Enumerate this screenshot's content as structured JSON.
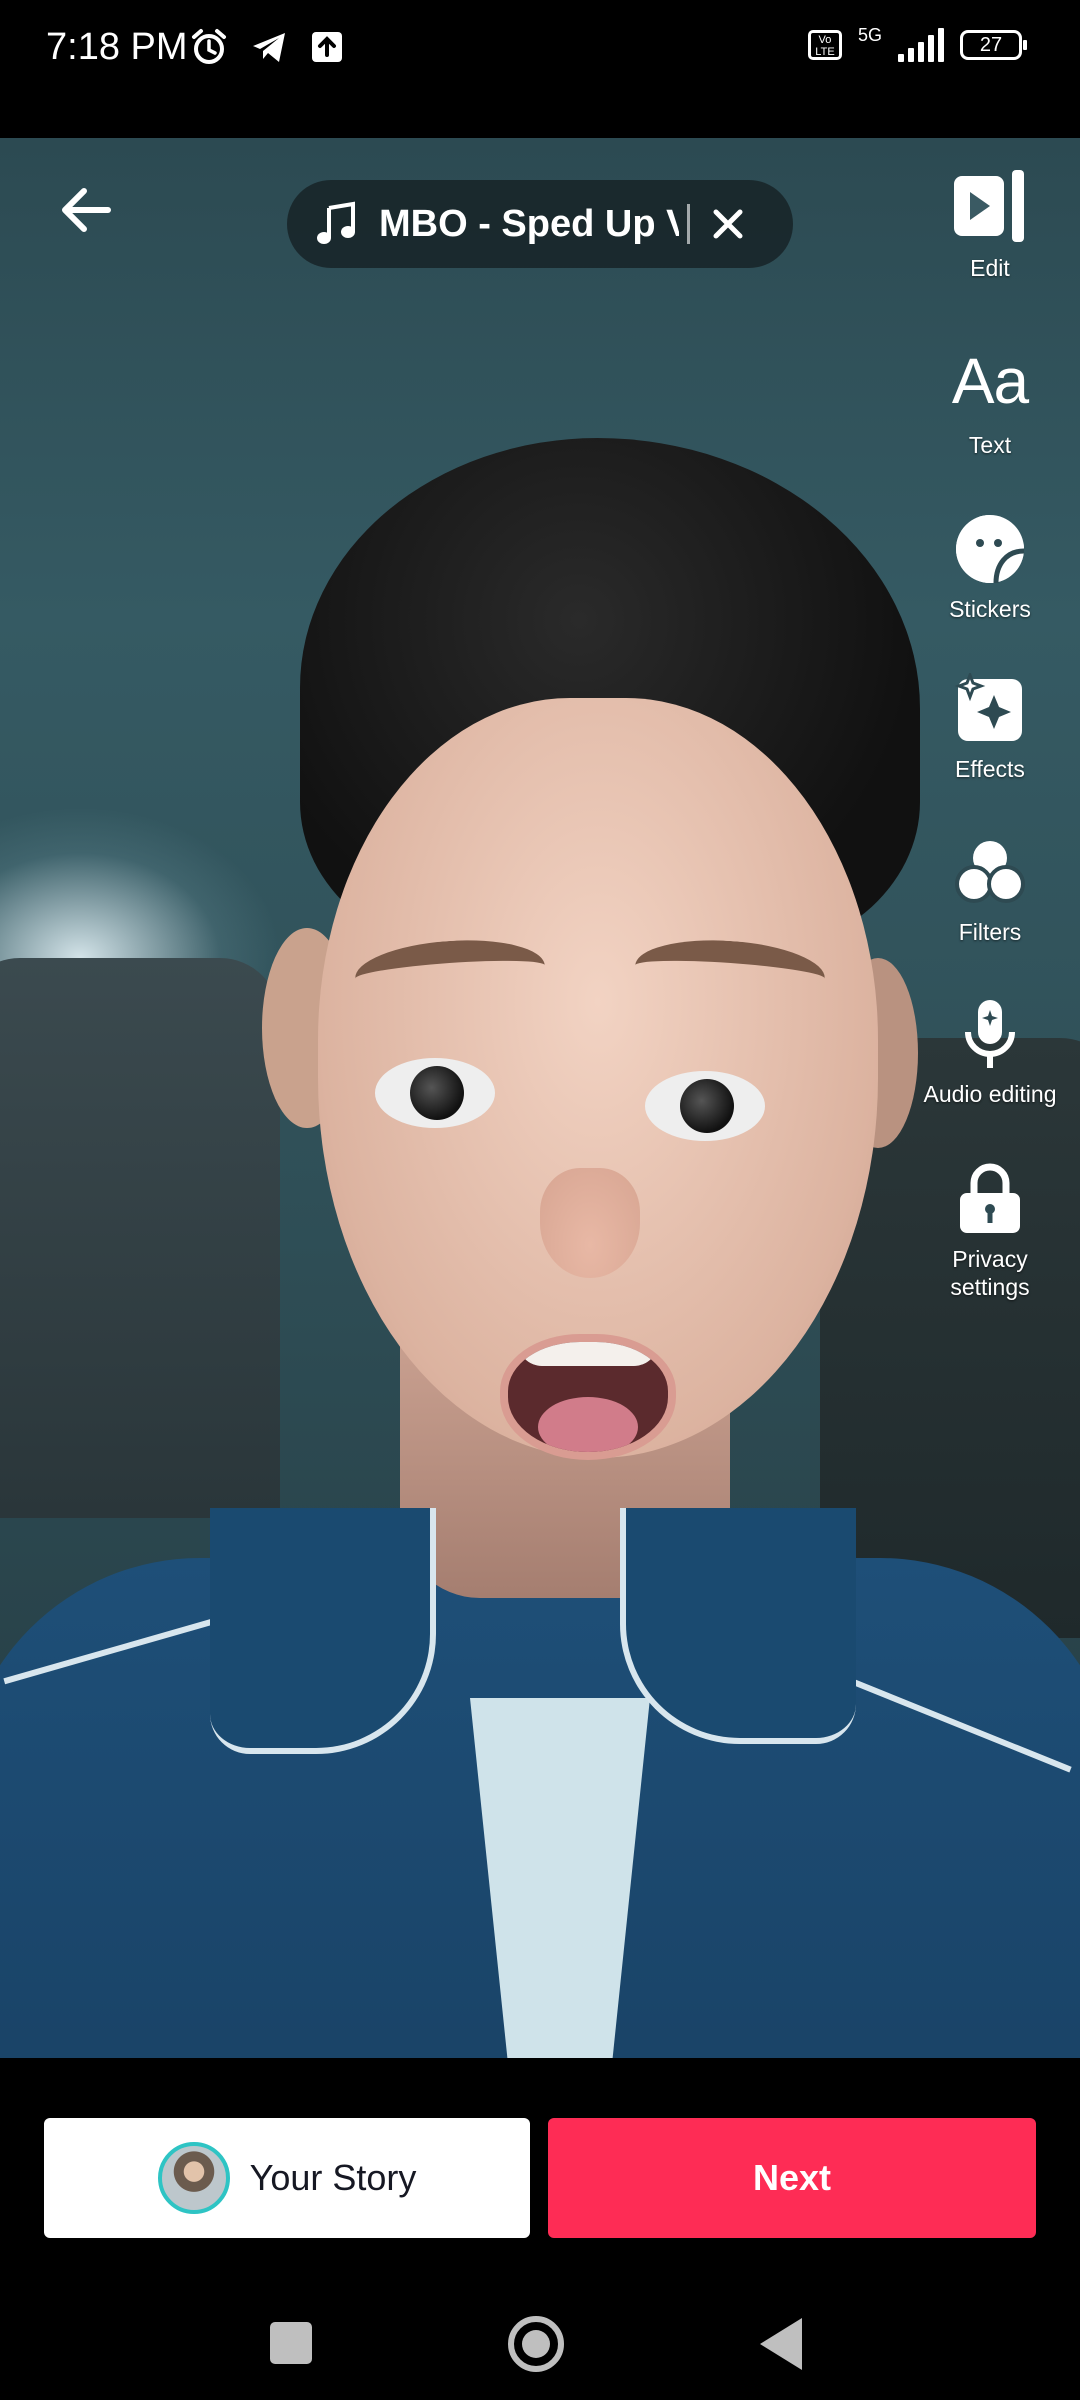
{
  "status_bar": {
    "time": "7:18 PM",
    "network": "5G",
    "volte": "Vo LTE",
    "battery": "27"
  },
  "sound": {
    "title": "MBO - Sped Up V"
  },
  "toolbar": {
    "edit": "Edit",
    "text_icon": "Aa",
    "text": "Text",
    "stickers": "Stickers",
    "effects": "Effects",
    "filters": "Filters",
    "audio_editing": "Audio editing",
    "privacy_line1": "Privacy",
    "privacy_line2": "settings"
  },
  "actions": {
    "your_story": "Your Story",
    "next": "Next"
  },
  "colors": {
    "next_button": "#fe2c55",
    "story_ring": "#2ec4c4"
  }
}
